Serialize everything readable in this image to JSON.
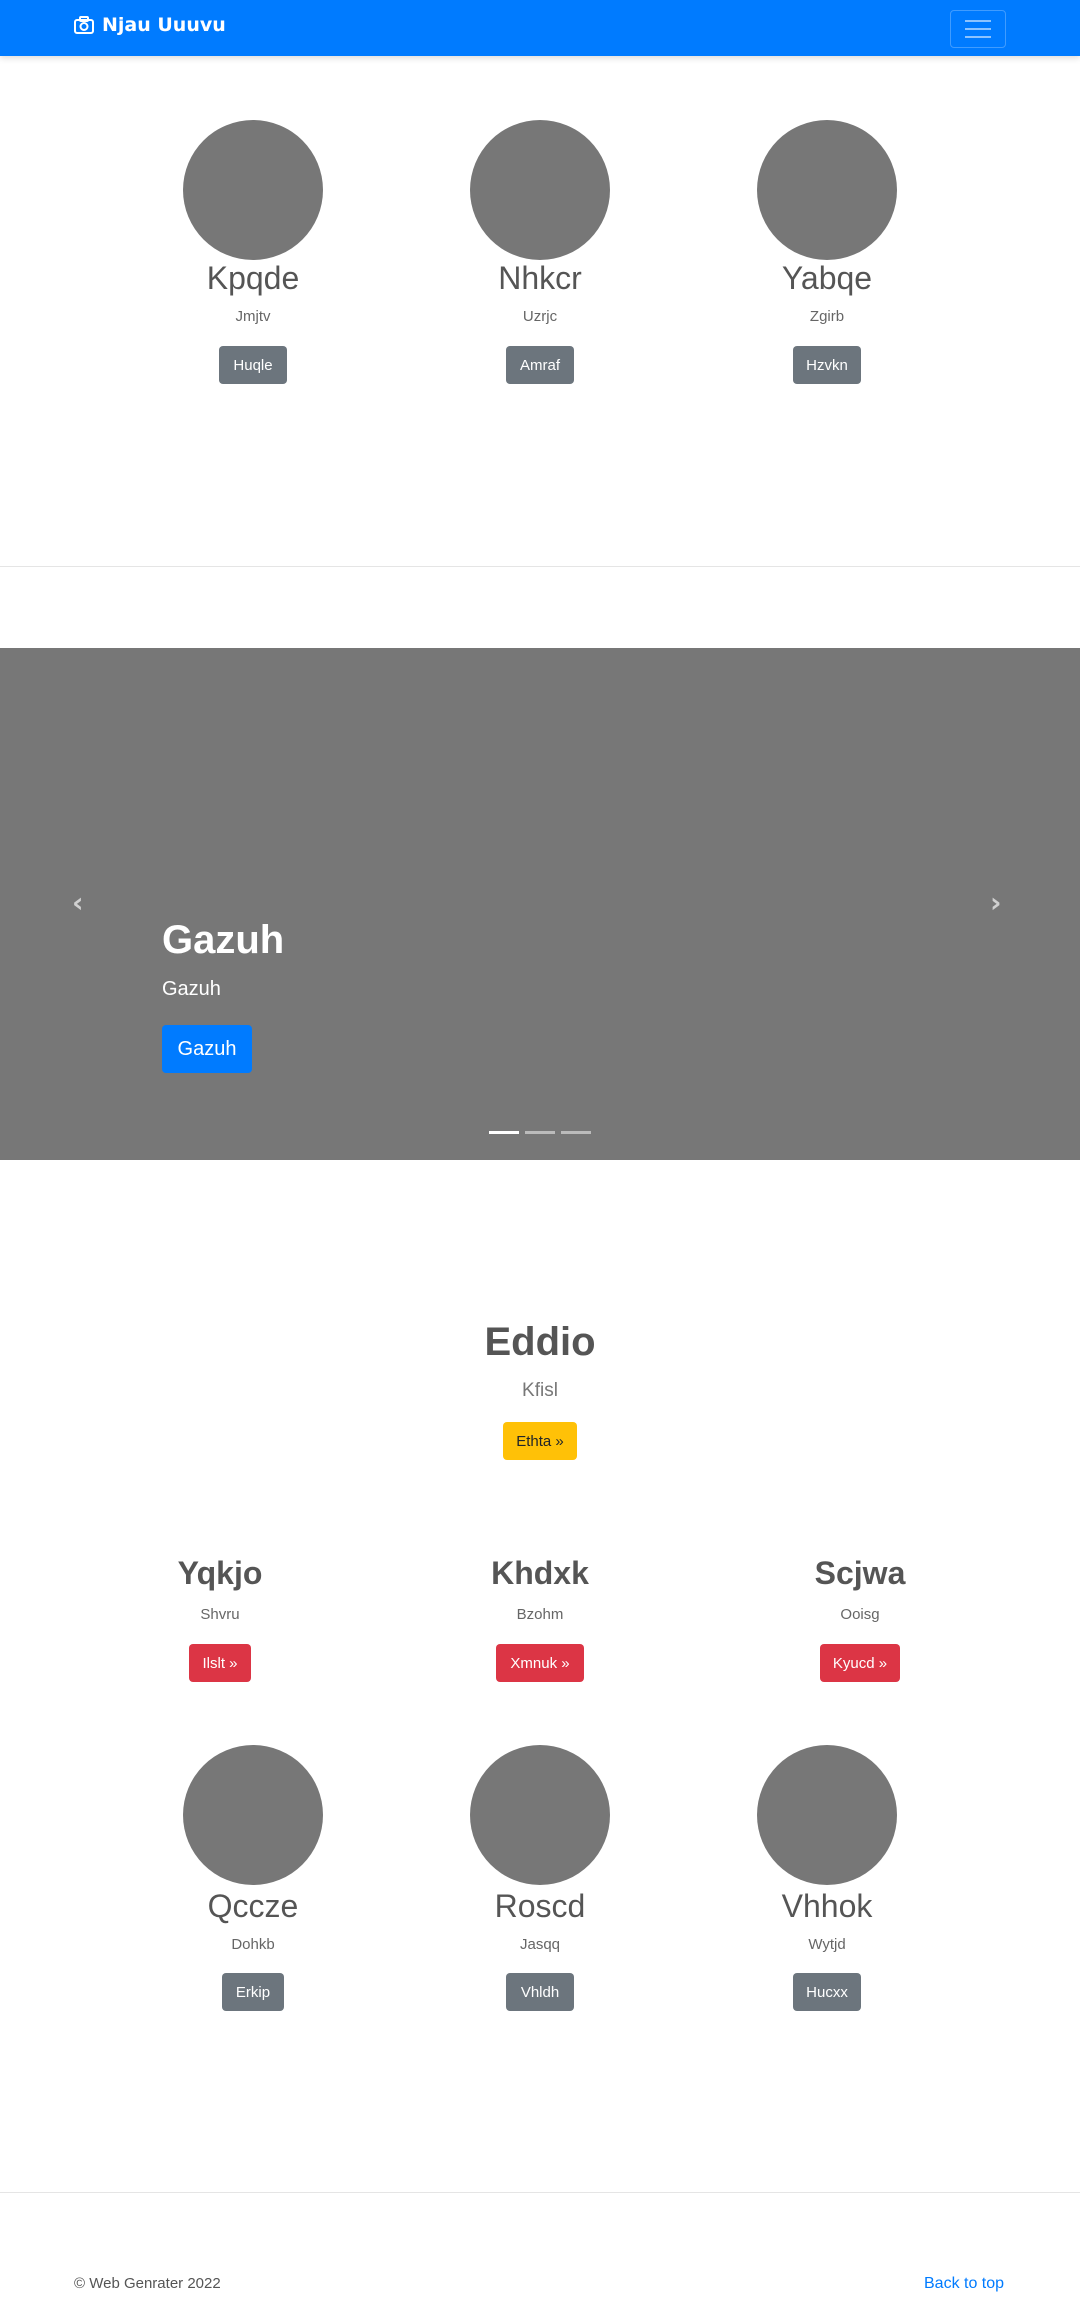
{
  "navbar": {
    "brand": "Njau Uuuvu",
    "icon": "camera-icon",
    "menu_icon": "hamburger-icon"
  },
  "profiles_top": [
    {
      "name": "Kpqde",
      "subtitle": "Jmjtv",
      "button": "Huqle"
    },
    {
      "name": "Nhkcr",
      "subtitle": "Uzrjc",
      "button": "Amraf"
    },
    {
      "name": "Yabqe",
      "subtitle": "Zgirb",
      "button": "Hzvkn"
    }
  ],
  "carousel": {
    "title": "Gazuh",
    "text": "Gazuh",
    "button": "Gazuh",
    "prev_icon": "chevron-left-icon",
    "next_icon": "chevron-right-icon",
    "slide_count": 3,
    "active_index": 0
  },
  "feature": {
    "title": "Eddio",
    "lead": "Kfisl",
    "button": "Ethta »"
  },
  "columns": [
    {
      "title": "Yqkjo",
      "text": "Shvru",
      "button": "Ilslt »"
    },
    {
      "title": "Khdxk",
      "text": "Bzohm",
      "button": "Xmnuk »"
    },
    {
      "title": "Scjwa",
      "text": "Ooisg",
      "button": "Kyucd »"
    }
  ],
  "profiles_bottom": [
    {
      "name": "Qccze",
      "subtitle": "Dohkb",
      "button": "Erkip"
    },
    {
      "name": "Roscd",
      "subtitle": "Jasqq",
      "button": "Vhldh"
    },
    {
      "name": "Vhhok",
      "subtitle": "Wytjd",
      "button": "Hucxx"
    }
  ],
  "footer": {
    "copyright": "© Web Genrater 2022",
    "back_to_top": "Back to top"
  },
  "colors": {
    "primary": "#007bff",
    "secondary": "#6c757d",
    "danger": "#dc3545",
    "warning": "#ffc107",
    "placeholder": "#777777"
  }
}
